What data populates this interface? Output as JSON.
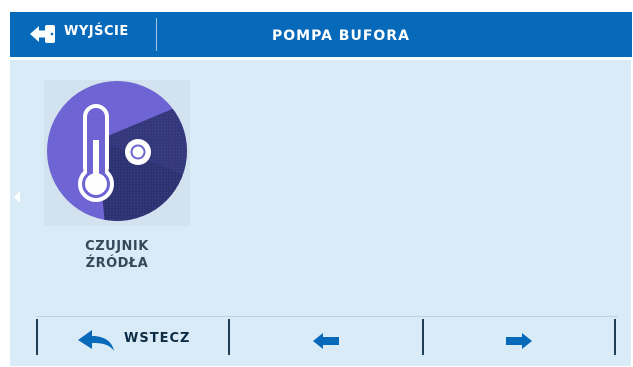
{
  "header": {
    "exit_label": "WYJŚCIE",
    "title": "POMPA BUFORA",
    "exit_icon": "exit-door-arrow-icon"
  },
  "main": {
    "tiles": [
      {
        "label_line1": "CZUJNIK",
        "label_line2": "ŹRÓDŁA",
        "icon": "thermometer-sensor-icon"
      }
    ]
  },
  "bottom_bar": {
    "back_label": "WSTECZ",
    "back_icon": "return-arrow-icon",
    "left_icon": "arrow-left-icon",
    "right_icon": "arrow-right-icon"
  },
  "colors": {
    "header": "#0769b9",
    "background": "#d9ebf7",
    "tile_circle": "#6e64d3",
    "arrow": "#0769b9",
    "text": "#34495a"
  }
}
